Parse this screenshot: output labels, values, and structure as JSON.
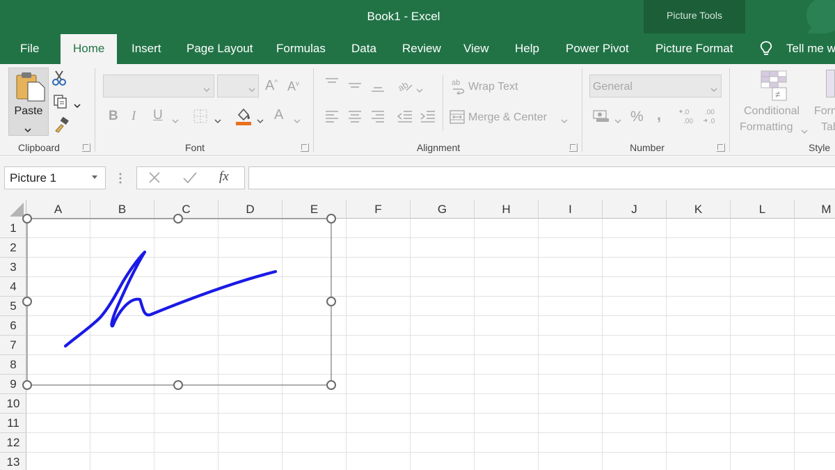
{
  "window": {
    "title": "Book1  -  Excel",
    "contextual_group": "Picture Tools"
  },
  "tabs": [
    {
      "label": "File"
    },
    {
      "label": "Home"
    },
    {
      "label": "Insert"
    },
    {
      "label": "Page Layout"
    },
    {
      "label": "Formulas"
    },
    {
      "label": "Data"
    },
    {
      "label": "Review"
    },
    {
      "label": "View"
    },
    {
      "label": "Help"
    },
    {
      "label": "Power Pivot"
    },
    {
      "label": "Picture Format"
    }
  ],
  "tell_me": "Tell me w",
  "ribbon": {
    "clipboard": {
      "label": "Clipboard",
      "paste": "Paste"
    },
    "font": {
      "label": "Font",
      "bold": "B",
      "italic": "I",
      "underline": "U",
      "font_color": "A"
    },
    "alignment": {
      "label": "Alignment",
      "wrap_text": "Wrap Text",
      "merge_center": "Merge & Center"
    },
    "number": {
      "label": "Number",
      "format": "General",
      "percent": "%",
      "comma": "̹"
    },
    "styles": {
      "label": "Style",
      "conditional_line1": "Conditional",
      "conditional_line2": "Formatting",
      "format_table_line1": "Form",
      "format_table_line2": "Tab"
    }
  },
  "formula_bar": {
    "name_box": "Picture 1",
    "fx": "fx",
    "value": ""
  },
  "columns": [
    "A",
    "B",
    "C",
    "D",
    "E",
    "F",
    "G",
    "H",
    "I",
    "J",
    "K",
    "L",
    "M"
  ],
  "rows": [
    "1",
    "2",
    "3",
    "4",
    "5",
    "6",
    "7",
    "8",
    "9",
    "10",
    "11",
    "12",
    "13"
  ],
  "signature_color": "#1a1ae6",
  "accent": "#217346"
}
